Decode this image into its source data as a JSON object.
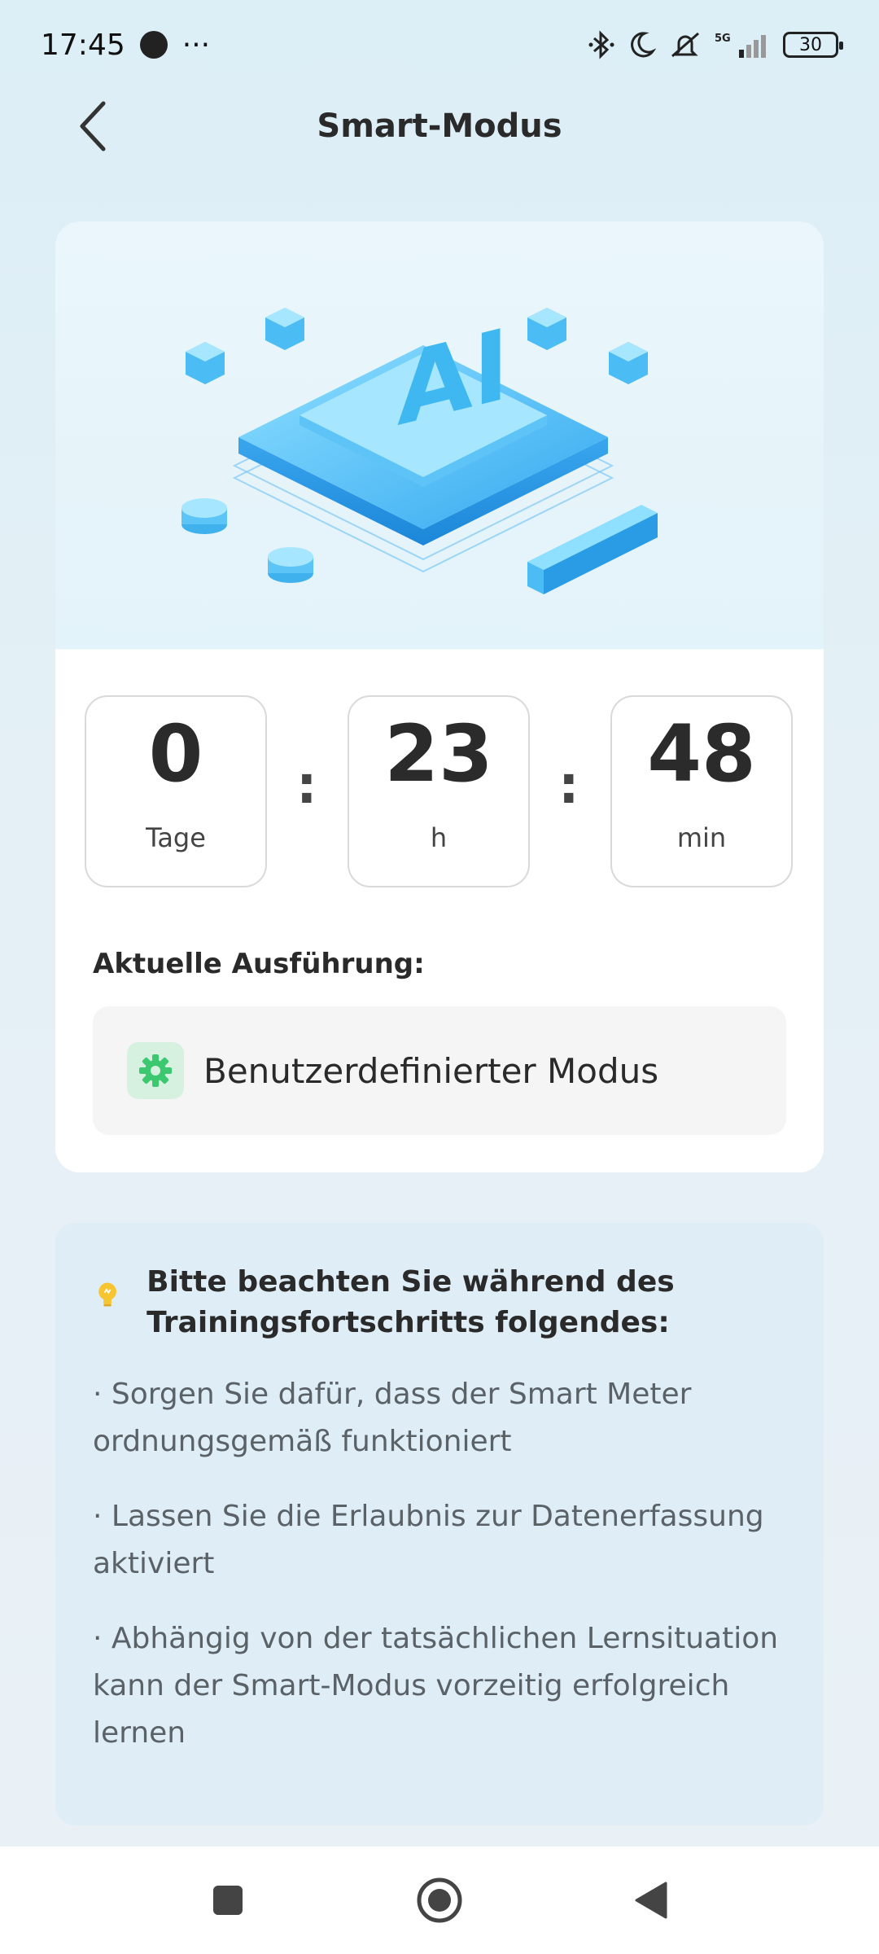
{
  "status_bar": {
    "time": "17:45",
    "more": "···",
    "battery": "30",
    "network": "5G"
  },
  "header": {
    "title": "Smart-Modus"
  },
  "timer": {
    "days": {
      "value": "0",
      "unit": "Tage"
    },
    "hours": {
      "value": "23",
      "unit": "h"
    },
    "minutes": {
      "value": "48",
      "unit": "min"
    },
    "separator": ":"
  },
  "execution": {
    "label": "Aktuelle Ausführung:",
    "mode": "Benutzerdefinierter Modus"
  },
  "notes": {
    "title": "Bitte beachten Sie während des Trainingsfortschritts folgendes:",
    "items": [
      "· Sorgen Sie dafür, dass der Smart Meter ordnungsgemäß funktioniert",
      "· Lassen Sie die Erlaubnis zur Datenerfassung aktiviert",
      "· Abhängig von der tatsächlichen Lernsituation kann der Smart-Modus vorzeitig erfolgreich lernen"
    ]
  },
  "illustration": {
    "text": "AI"
  },
  "colors": {
    "accent_blue": "#3db4f2",
    "gear_green": "#3cc86e",
    "bulb_yellow": "#f7c531"
  }
}
